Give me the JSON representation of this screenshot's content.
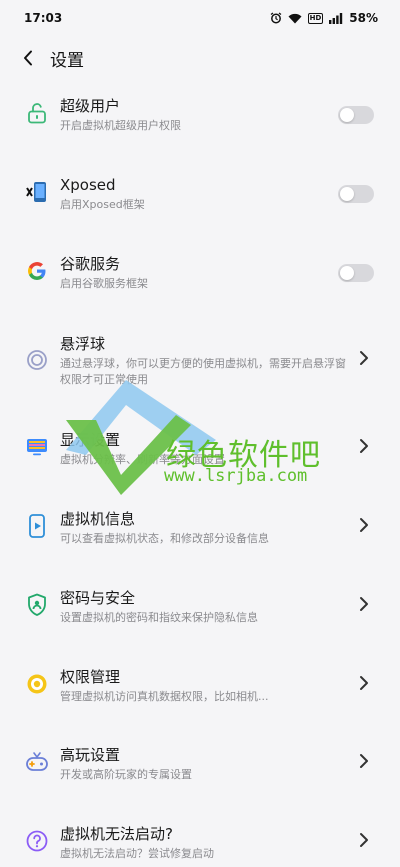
{
  "status_bar": {
    "time": "17:03",
    "battery": "58%",
    "hd": "HD"
  },
  "header": {
    "title": "设置"
  },
  "items": [
    {
      "title": "超级用户",
      "desc": "开启虚拟机超级用户权限",
      "control": "toggle",
      "on": false,
      "icon": "lock-open-icon"
    },
    {
      "title": "Xposed",
      "desc": "启用Xposed框架",
      "control": "toggle",
      "on": false,
      "icon": "xposed-icon"
    },
    {
      "title": "谷歌服务",
      "desc": "启用谷歌服务框架",
      "control": "toggle",
      "on": false,
      "icon": "google-icon"
    },
    {
      "title": "悬浮球",
      "desc": "通过悬浮球，你可以更方便的使用虚拟机，需要开启悬浮窗权限才可正常使用",
      "control": "chevron",
      "icon": "floating-ball-icon"
    },
    {
      "title": "显示设置",
      "desc": "虚拟机分辨率、刷新率等方面设置",
      "control": "chevron",
      "icon": "display-icon"
    },
    {
      "title": "虚拟机信息",
      "desc": "可以查看虚拟机状态，和修改部分设备信息",
      "control": "chevron",
      "icon": "phone-info-icon"
    },
    {
      "title": "密码与安全",
      "desc": "设置虚拟机的密码和指纹来保护隐私信息",
      "control": "chevron",
      "icon": "shield-icon"
    },
    {
      "title": "权限管理",
      "desc": "管理虚拟机访问真机数据权限，比如相机...",
      "control": "chevron",
      "icon": "permission-icon"
    },
    {
      "title": "高玩设置",
      "desc": "开发或高阶玩家的专属设置",
      "control": "chevron",
      "icon": "gamepad-icon"
    },
    {
      "title": "虚拟机无法启动?",
      "desc": "虚拟机无法启动？尝试修复启动",
      "control": "chevron",
      "icon": "help-icon"
    }
  ],
  "watermark": {
    "name": "绿色软件吧",
    "url": "www.lsrjba.com"
  },
  "colors": {
    "accent_green": "#3cb878",
    "toggle_off": "#d8d8dc",
    "watermark": "#5fbf2c"
  }
}
